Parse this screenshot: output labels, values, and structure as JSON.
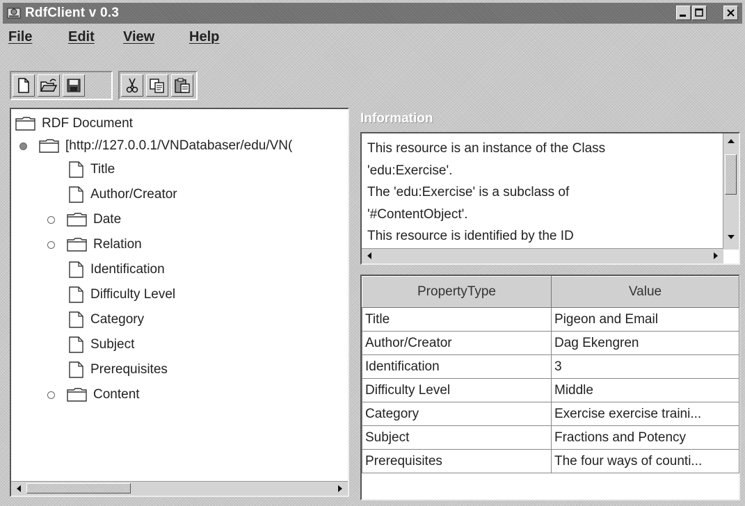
{
  "window": {
    "title": "RdfClient v 0.3"
  },
  "menu": [
    "File",
    "Edit",
    "View",
    "Help"
  ],
  "toolbar": {
    "file_icons": [
      "new-document-icon",
      "open-folder-icon",
      "save-disk-icon"
    ],
    "edit_icons": [
      "cut-scissors-icon",
      "copy-icon",
      "paste-icon"
    ]
  },
  "tree": {
    "root": "RDF Document",
    "resource": "[http://127.0.0.1/VNDatabaser/edu/VN(",
    "children": [
      {
        "label": "Title",
        "type": "leaf"
      },
      {
        "label": "Author/Creator",
        "type": "leaf"
      },
      {
        "label": "Date",
        "type": "folder"
      },
      {
        "label": "Relation",
        "type": "folder"
      },
      {
        "label": "Identification",
        "type": "leaf"
      },
      {
        "label": "Difficulty Level",
        "type": "leaf"
      },
      {
        "label": "Category",
        "type": "leaf"
      },
      {
        "label": "Subject",
        "type": "leaf"
      },
      {
        "label": "Prerequisites",
        "type": "leaf"
      },
      {
        "label": "Content",
        "type": "folder"
      }
    ]
  },
  "information": {
    "header": "Information",
    "lines": [
      "This resource is an instance of the Class",
      "'edu:Exercise'.",
      "The 'edu:Exercise' is a subclass of",
      "'#ContentObject'.",
      "This resource is identified by the ID"
    ]
  },
  "table": {
    "columns": [
      "PropertyType",
      "Value"
    ],
    "rows": [
      [
        "Title",
        "Pigeon and Email"
      ],
      [
        "Author/Creator",
        "Dag Ekengren"
      ],
      [
        "Identification",
        "3"
      ],
      [
        "Difficulty Level",
        "Middle"
      ],
      [
        "Category",
        "Exercise exercise traini..."
      ],
      [
        "Subject",
        "Fractions and Potency"
      ],
      [
        "Prerequisites",
        "The four ways of counti..."
      ]
    ]
  }
}
